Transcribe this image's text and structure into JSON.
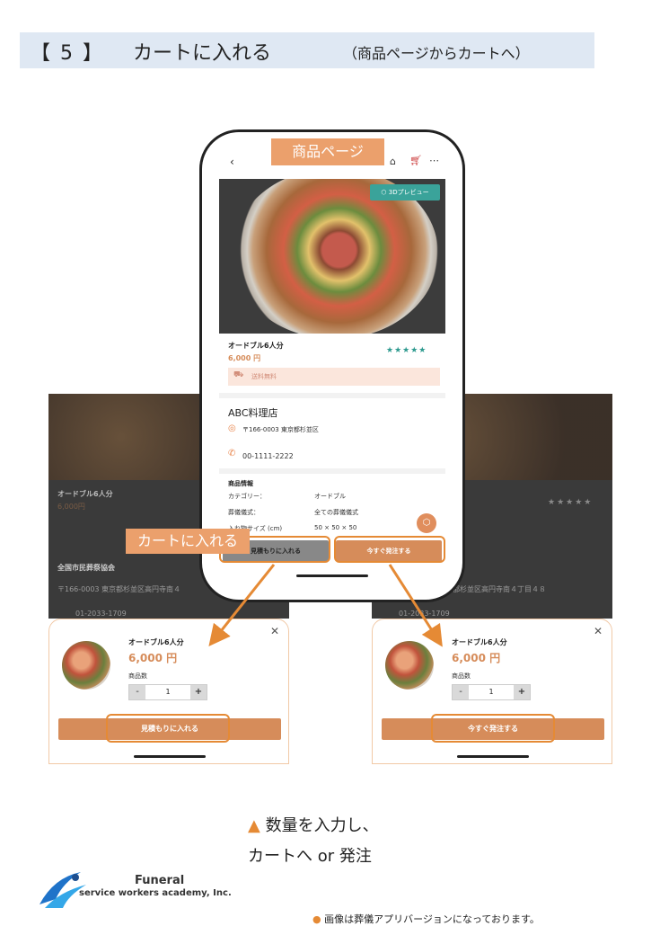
{
  "header": {
    "step": "【 5 】",
    "title": "カートに入れる",
    "subtitle": "（商品ページからカートへ）"
  },
  "callouts": {
    "product_page": "商品ページ",
    "add_to_cart": "カートに入れる"
  },
  "phone": {
    "nav": {
      "back_icon": "chevron-left-icon",
      "home_icon": "home-icon",
      "cart_icon": "cart-icon",
      "more_icon": "more-icon"
    },
    "preview_3d": "3Dプレビュー",
    "product": {
      "name": "オードブル6人分",
      "price": "6,000 円",
      "rating": "★★★★★",
      "shipping": "送料無料"
    },
    "shop": {
      "name": "ABC料理店",
      "address": "〒166-0003 東京都杉並区",
      "tel": "00-1111-2222"
    },
    "info": {
      "title": "商品情報",
      "rows": [
        {
          "label": "カテゴリー：",
          "value": "オードブル"
        },
        {
          "label": "葬儀儀式：",
          "value": "全ての葬儀儀式"
        },
        {
          "label": "入れ物サイズ (cm)",
          "value": "50 × 50 × 50"
        }
      ]
    },
    "buttons": {
      "quote": "見積もりに入れる",
      "order": "今すぐ発注する"
    }
  },
  "background": {
    "name": "オードブル6人分",
    "price": "6,000円",
    "shop": "全国市民葬祭協会",
    "address_left": "〒166-0003 東京都杉並区高円寺南４",
    "address_right": "都杉並区高円寺南４丁目４８",
    "tel_left": "01-2033-1709",
    "tel_right": "01-2033-1709",
    "stars": "★★★★★"
  },
  "sheets": {
    "left": {
      "name": "オードブル6人分",
      "price": "6,000 円",
      "qty_label": "商品数",
      "qty": "1",
      "cta": "見積もりに入れる"
    },
    "right": {
      "name": "オードブル6人分",
      "price": "6,000 円",
      "qty_label": "商品数",
      "qty": "1",
      "cta": "今すぐ発注する"
    }
  },
  "captions": {
    "line1_icon": "▲",
    "line1": "数量を入力し、",
    "line2": "カートへ or 発注"
  },
  "logo": {
    "name": "Funeral",
    "subtitle": "service workers academy, Inc."
  },
  "note": "画像は葬儀アプリバージョンになっております。",
  "colors": {
    "accent": "#d68c5a",
    "highlight": "#e58a35",
    "teal": "#3aa39a",
    "title_bar": "#dfe8f3"
  }
}
